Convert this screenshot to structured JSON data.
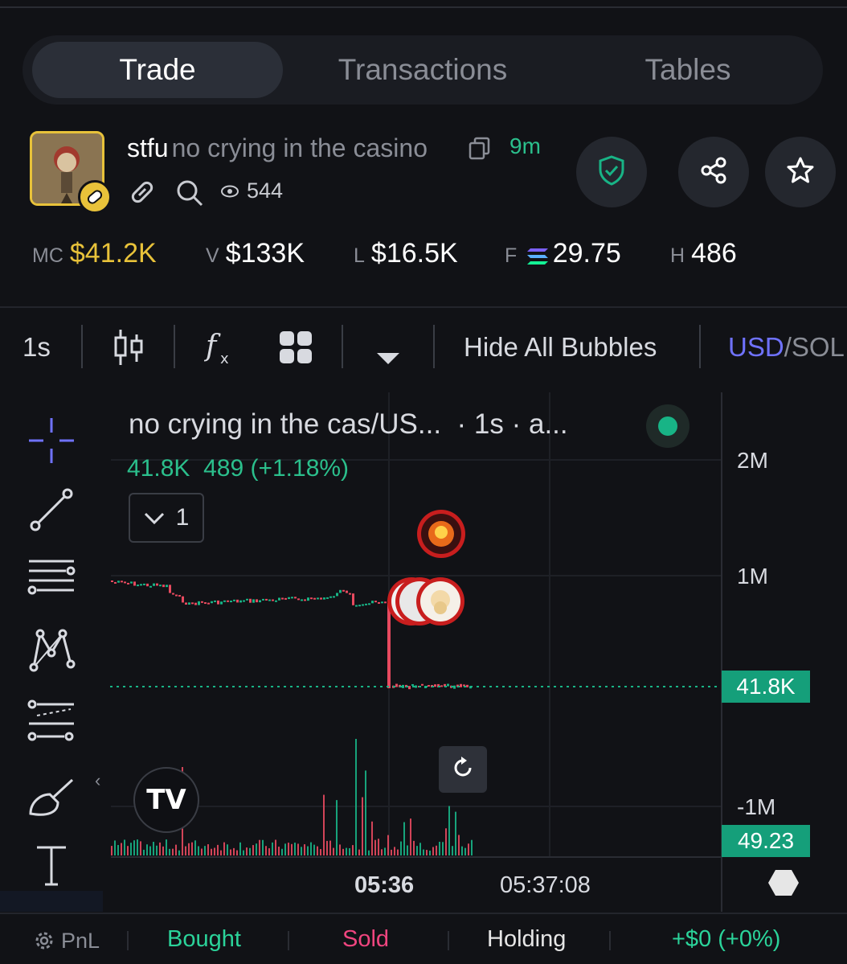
{
  "tabs": [
    {
      "label": "Trade",
      "active": true
    },
    {
      "label": "Transactions",
      "active": false
    },
    {
      "label": "Tables",
      "active": false
    }
  ],
  "token": {
    "symbol": "stfu",
    "name": "no crying in the casino",
    "age": "9m",
    "views": "544"
  },
  "stats": {
    "mc_label": "MC",
    "mc_value": "$41.2K",
    "v_label": "V",
    "v_value": "$133K",
    "l_label": "L",
    "l_value": "$16.5K",
    "f_label": "F",
    "f_value": "29.75",
    "h_label": "H",
    "h_value": "486"
  },
  "toolbar": {
    "interval": "1s",
    "hide_bubbles": "Hide All Bubbles",
    "currency_active": "USD",
    "currency_sep": "/",
    "currency_other": "SOL"
  },
  "chart": {
    "title": "no crying in the cas/US...",
    "subtitle": "· 1s · a...",
    "last_value": "41.8K",
    "change_value": "489",
    "change_pct": "(+1.18%)",
    "collapse_count": "1",
    "y_labels": [
      "2M",
      "1M",
      "-1M"
    ],
    "price_tag": "41.8K",
    "volume_tag": "49.23",
    "time_labels": [
      "05:36",
      "05:37:08"
    ],
    "tv_logo": "TV",
    "colors": {
      "up": "#18b486",
      "down": "#e84a5f"
    }
  },
  "chart_data": {
    "type": "candlestick",
    "title": "no crying in the cas/US...",
    "y_ticks": [
      "2M",
      "1M",
      "-1M"
    ],
    "x_ticks": [
      "05:36",
      "05:37:08"
    ],
    "last_price": "41.8K",
    "last_volume": "49.23",
    "pre_drop_level_approx": 950000,
    "post_drop_level_approx": 41800
  },
  "bottom": {
    "pnl": "PnL",
    "bought": "Bought",
    "sold": "Sold",
    "holding": "Holding",
    "total": "+$0 (+0%)"
  }
}
